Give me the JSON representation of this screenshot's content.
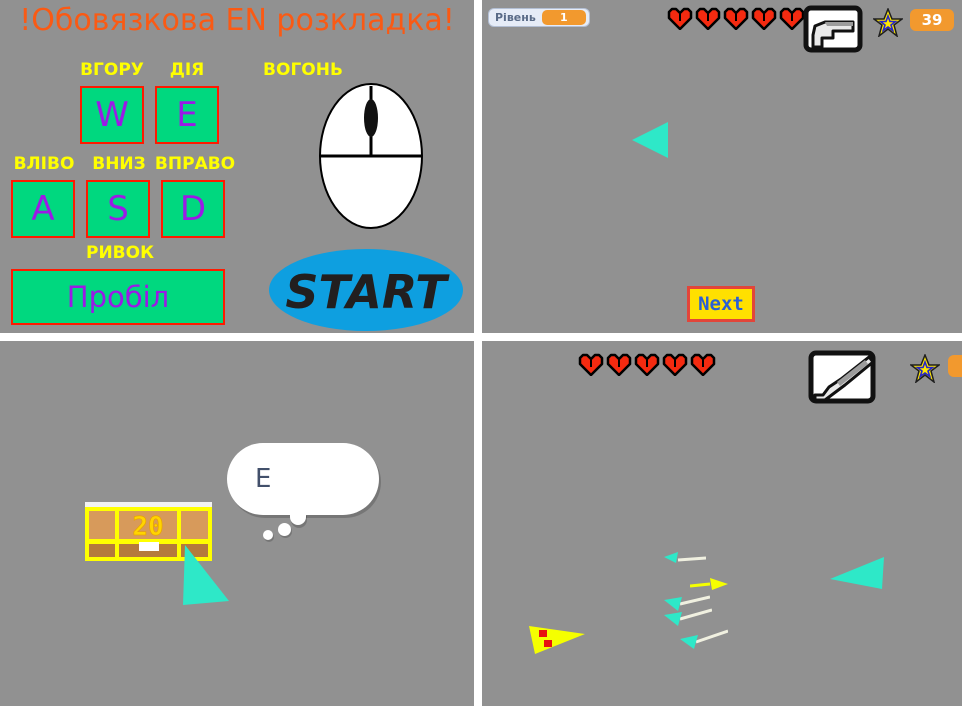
{
  "page": {
    "background": "#919191",
    "divider_color": "#ffffff"
  },
  "controls_panel": {
    "title": "!Обовязкова EN розкладка!",
    "title_color": "#fa5a14",
    "key_label_color": "#ffff00",
    "keycap_fill": "#00d87f",
    "keycap_border": "#ff1a00",
    "keycap_text_color": "#9b1ae6",
    "keys": [
      {
        "label": "ВГОРУ",
        "cap": "W"
      },
      {
        "label": "ДІЯ",
        "cap": "E"
      },
      {
        "label": "ВЛІВО",
        "cap": "A"
      },
      {
        "label": "ВНИЗ",
        "cap": "S"
      },
      {
        "label": "ВПРАВО",
        "cap": "D"
      },
      {
        "label": "РИВОК",
        "cap": "Пробіл"
      }
    ],
    "mouse": {
      "label": "ВОГОНЬ",
      "icon": "mouse-icon",
      "body_color": "#ffffff",
      "outline_color": "#000000"
    },
    "start_button": {
      "label": "START",
      "fill": "#0e9fe0",
      "text_color": "#221f1f",
      "icon": "start-button"
    }
  },
  "level_panel": {
    "readout": {
      "label": "Рівень",
      "value": "1"
    },
    "lives": 5,
    "heart_color": "#f42a10",
    "weapon_icon": "pistol-icon",
    "star_icon": "star-icon",
    "score": "39",
    "score_color": "#f2992e",
    "next_button": {
      "label": "Next",
      "fill": "#ffe000",
      "border": "#e2453a",
      "text_color": "#2a5fd6"
    },
    "player_ship": {
      "icon": "cyan-triangle-ship",
      "color": "#2ee8c8",
      "facing": "left"
    }
  },
  "chest_panel": {
    "chest": {
      "icon": "treasure-chest-icon",
      "amount": "20",
      "outline_color": "#ffff00",
      "top_color": "#d79a5b",
      "bottom_color": "#b57a3c",
      "lock_color": "#ffffff"
    },
    "speech_bubble": {
      "text": "E",
      "fill": "#ffffff",
      "text_color": "#42506b"
    },
    "player_ship": {
      "icon": "cyan-triangle-ship",
      "color": "#2ee8c8",
      "facing": "down-right"
    }
  },
  "combat_panel": {
    "lives": 5,
    "heart_color": "#f42a10",
    "weapon_icon": "shotgun-icon",
    "star_icon": "star-icon",
    "score_visible": true,
    "player_ship": {
      "icon": "cyan-triangle-ship",
      "color": "#2ee8c8",
      "facing": "left"
    },
    "enemy_ship": {
      "icon": "yellow-triangle-enemy",
      "color": "#f5ff00",
      "facing": "right"
    },
    "projectiles": [
      {
        "icon": "cyan-bullet",
        "color": "#2ee8c8"
      },
      {
        "icon": "yellow-bullet",
        "color": "#f5ff00"
      },
      {
        "icon": "cyan-bullet",
        "color": "#2ee8c8"
      },
      {
        "icon": "cyan-bullet",
        "color": "#2ee8c8"
      },
      {
        "icon": "cyan-bullet",
        "color": "#2ee8c8"
      }
    ]
  }
}
